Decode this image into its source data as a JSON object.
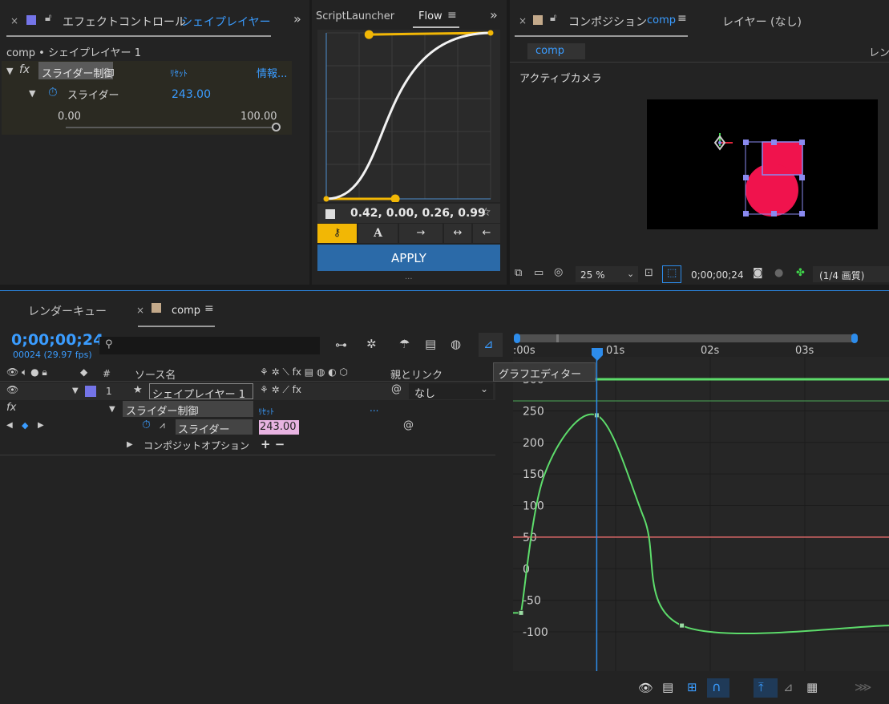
{
  "colors": {
    "bg": "#232323",
    "accent_blue": "#2d8ceb",
    "curve_green": "#5ddc6b",
    "keyframe_highlight": "#e8b4e2",
    "flow_yellow": "#f2b705",
    "apply_blue": "#2b6aa8",
    "shape_red": "#f0134d",
    "handle_purple": "#8a8af0"
  },
  "effect_panel": {
    "tab_label": "エフェクトコントロール",
    "tab_layer": "シェイプレイヤー 1",
    "breadcrumb": "comp • シェイプレイヤー 1",
    "effect_name": "スライダー制御",
    "reset_label": "ﾘｾｯﾄ",
    "info_label": "情報...",
    "slider_label": "スライダー",
    "slider_value": "243.00",
    "range_min": "0.00",
    "range_max": "100.00",
    "slider_fraction": 1.0
  },
  "flow_panel": {
    "tab_script": "ScriptLauncher",
    "tab_flow": "Flow",
    "bezier_values": "0.42, 0.00, 0.26, 0.99",
    "bezier": [
      0.42,
      0.0,
      0.26,
      0.99
    ],
    "apply_label": "APPLY",
    "ellipsis": "..."
  },
  "comp_panel": {
    "tab_label": "コンポジション",
    "tab_comp": "comp",
    "layer_tab": "レイヤー (なし)",
    "sub_tab": "comp",
    "sub_tab_right": "レン",
    "camera_label": "アクティブカメラ",
    "zoom": "25 %",
    "timecode": "0;00;00;24",
    "resolution": "(1/4 画質)"
  },
  "timeline": {
    "render_queue_tab": "レンダーキュー",
    "comp_tab": "comp",
    "timecode": "0;00;00;24",
    "frame_info": "00024 (29.97 fps)",
    "search_placeholder": "",
    "col_source": "ソース名",
    "col_parent": "親とリンク",
    "col_num": "#",
    "tooltip": "グラフエディター",
    "layer_index": "1",
    "layer_name": "シェイプレイヤー 1",
    "parent_value": "なし",
    "effect_row": "スライダー制御",
    "effect_reset": "ﾘｾｯﾄ",
    "effect_more": "...",
    "prop_name": "スライダー",
    "prop_value": "243.00",
    "composite_row": "コンポジットオプション",
    "composite_ops": "+ −",
    "time_labels": [
      ":00s",
      "01s",
      "02s",
      "03s"
    ],
    "y_labels": [
      "300",
      "250",
      "200",
      "150",
      "100",
      "50",
      "0",
      "-50",
      "-100"
    ],
    "graph_points": [
      {
        "t": 0.0,
        "v": -70
      },
      {
        "t": 0.25,
        "v": 150
      },
      {
        "t": 0.8,
        "v": 243
      },
      {
        "t": 1.3,
        "v": 80
      },
      {
        "t": 1.7,
        "v": -90
      },
      {
        "t": 3.5,
        "v": -90
      }
    ]
  }
}
